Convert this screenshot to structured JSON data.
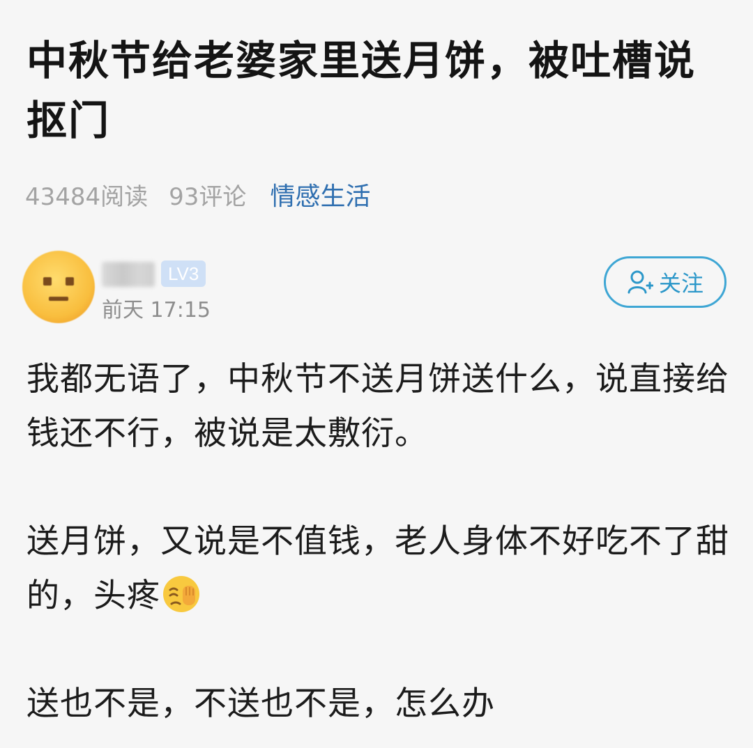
{
  "post": {
    "title": "中秋节给老婆家里送月饼，被吐槽说抠门",
    "reads": "43484阅读",
    "comments": "93评论",
    "category": "情感生活"
  },
  "author": {
    "avatar_icon": "slightly-smiling-face-icon",
    "level": "LV3",
    "time": "前天 17:15"
  },
  "follow": {
    "label": "关注",
    "icon": "add-user-icon",
    "color": "#3ea6d4"
  },
  "body": {
    "paragraph1": "我都无语了，中秋节不送月饼送什么，说直接给钱还不行，被说是太敷衍。",
    "paragraph2": "送月饼，又说是不值钱，老人身体不好吃不了甜的，头疼",
    "paragraph2_emoji": "facepalm-emoji",
    "paragraph3": "送也不是，不送也不是，怎么办"
  },
  "colors": {
    "category": "#2f6fb0",
    "meta": "#a3a3a3",
    "level_badge": "#cfe0f6"
  }
}
